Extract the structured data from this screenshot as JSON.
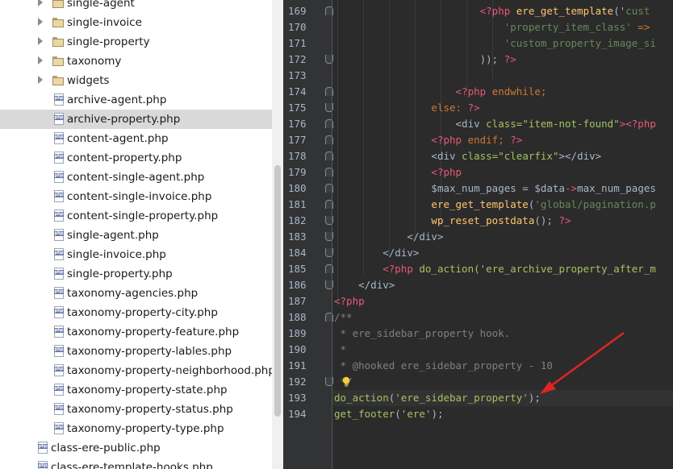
{
  "tree": {
    "folders": [
      "single-agent",
      "single-invoice",
      "single-property",
      "taxonomy",
      "widgets"
    ],
    "files": [
      "archive-agent.php",
      "archive-property.php",
      "content-agent.php",
      "content-property.php",
      "content-single-agent.php",
      "content-single-invoice.php",
      "content-single-property.php",
      "single-agent.php",
      "single-invoice.php",
      "single-property.php",
      "taxonomy-agencies.php",
      "taxonomy-property-city.php",
      "taxonomy-property-feature.php",
      "taxonomy-property-lables.php",
      "taxonomy-property-neighborhood.php",
      "taxonomy-property-state.php",
      "taxonomy-property-status.php",
      "taxonomy-property-type.php"
    ],
    "selected_file": "archive-property.php",
    "root_files": [
      "class-ere-public.php",
      "class-ere-template-hooks.php"
    ],
    "file_icon_tag": "php"
  },
  "editor": {
    "line_numbers": [
      "169",
      "170",
      "171",
      "172",
      "173",
      "174",
      "175",
      "176",
      "177",
      "178",
      "179",
      "180",
      "181",
      "182",
      "183",
      "184",
      "185",
      "186",
      "187",
      "188",
      "189",
      "190",
      "191",
      "192",
      "193",
      "194"
    ],
    "lines": {
      "l169_a": "<?php ",
      "l169_b": "ere_get_template",
      "l169_c": "('",
      "l169_d": "cust",
      "l170_a": "'property_item_class'",
      "l170_b": " =>",
      "l171_a": "'custom_property_image_si",
      "l172_a": ")); ",
      "l172_b": "?>",
      "l174_a": "<?php ",
      "l174_b": "endwhile",
      "l174_c": ";",
      "l175_a": "else",
      "l175_b": ": ",
      "l175_c": "?>",
      "l176_a": "<",
      "l176_b": "div",
      "l176_c": " class=",
      "l176_d": "\"item-not-found\"",
      "l176_e": "><?php",
      "l177_a": "<?php ",
      "l177_b": "endif",
      "l177_c": "; ",
      "l177_d": "?>",
      "l178_a": "<",
      "l178_b": "div",
      "l178_c": " class=",
      "l178_d": "\"clearfix\"",
      "l178_e": "></",
      "l178_f": "div",
      "l178_g": ">",
      "l179_a": "<?php",
      "l180_a": "$max_num_pages",
      "l180_b": " = ",
      "l180_c": "$data",
      "l180_d": "->",
      "l180_e": "max_num_pages",
      "l181_a": "ere_get_template",
      "l181_b": "(",
      "l181_c": "'global/pagination.p",
      "l182_a": "wp_reset_postdata",
      "l182_b": "(); ",
      "l182_c": "?>",
      "l183_a": "</",
      "l183_b": "div",
      "l183_c": ">",
      "l184_a": "</",
      "l184_b": "div",
      "l184_c": ">",
      "l185_a": "<?php ",
      "l185_b": "do_action",
      "l185_c": "(",
      "l185_d": "'ere_archive_property_after_m",
      "l186_a": "</",
      "l186_b": "div",
      "l186_c": ">",
      "l187_a": "<?php",
      "l188_a": "/**",
      "l189_a": " * ere_sidebar_property hook.",
      "l190_a": " *",
      "l191_a": " * @hooked ere_sidebar_property - 10",
      "l192_a": " */",
      "l193_a": "do_action",
      "l193_b": "(",
      "l193_c": "'ere_sidebar_property'",
      "l193_d": ");",
      "l194_a": "get_footer",
      "l194_b": "(",
      "l194_c": "'ere'",
      "l194_d": ");"
    },
    "current_line": "193",
    "arrow_color": "#e02424"
  },
  "colors": {
    "editor_bg": "#2b2b2b",
    "gutter_bg": "#313335",
    "selected_row": "#d9d9d9"
  }
}
